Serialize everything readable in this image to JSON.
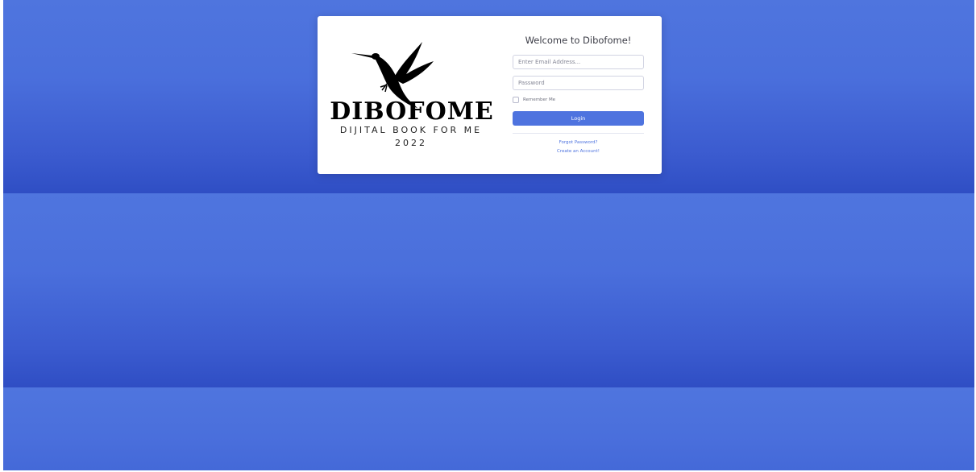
{
  "brand": {
    "name": "DIBOFOME",
    "tagline": "DIJITAL BOOK FOR ME",
    "year": "2022",
    "logo_icon": "hummingbird-icon"
  },
  "login": {
    "title": "Welcome to Dibofome!",
    "email_placeholder": "Enter Email Address...",
    "password_placeholder": "Password",
    "remember_label": "Remember Me",
    "remember_checked": false,
    "login_label": "Login",
    "forgot_password_label": "Forgot Password?",
    "create_account_label": "Create an Account!"
  },
  "colors": {
    "background": "#4e73df",
    "accent": "#4e73df",
    "card": "#ffffff"
  }
}
